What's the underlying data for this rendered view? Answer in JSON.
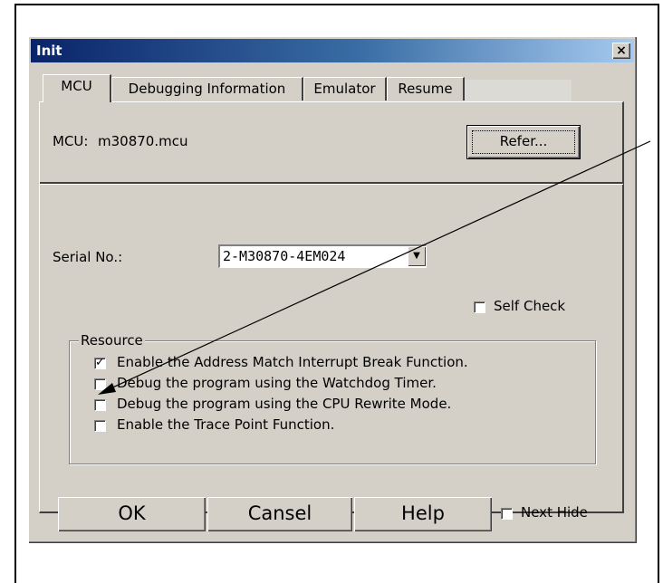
{
  "window": {
    "title": "Init",
    "close_glyph": "×"
  },
  "tabs": [
    {
      "label": "MCU",
      "active": true
    },
    {
      "label": "Debugging Information",
      "active": false
    },
    {
      "label": "Emulator",
      "active": false
    },
    {
      "label": "Resume",
      "active": false
    }
  ],
  "mcu": {
    "label": "MCU:",
    "value": "m30870.mcu",
    "refer_label": "Refer..."
  },
  "serial": {
    "label": "Serial No.:",
    "value": "2-M30870-4EM024",
    "arrow_icon": "dropdown-arrow-icon"
  },
  "self_check": {
    "label": "Self Check",
    "checked": false
  },
  "resource": {
    "legend": "Resource",
    "options": [
      {
        "label": "Enable the Address Match Interrupt Break Function.",
        "checked": true
      },
      {
        "label": "Debug the program using the Watchdog Timer.",
        "checked": false
      },
      {
        "label": "Debug the program using the CPU Rewrite Mode.",
        "checked": false
      },
      {
        "label": "Enable the Trace Point Function.",
        "checked": false
      }
    ]
  },
  "buttons": {
    "ok": "OK",
    "cancel": "Cansel",
    "help": "Help"
  },
  "next_hide": {
    "label": "Next Hide",
    "checked": false
  },
  "colors": {
    "dialog_face": "#d4d0c8",
    "title_start": "#0a246a",
    "title_end": "#a6caf0"
  }
}
